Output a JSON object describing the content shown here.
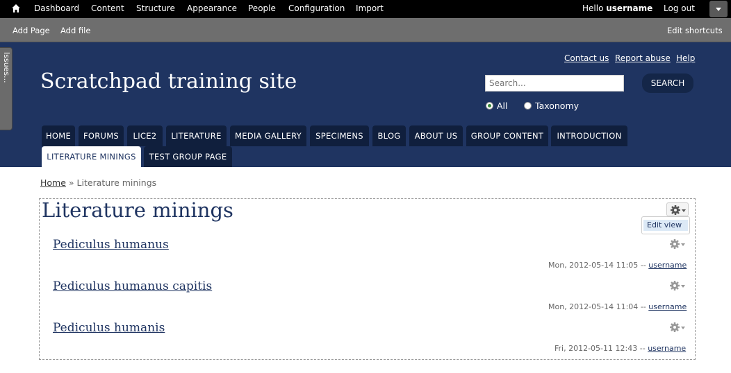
{
  "admin_bar": {
    "menu": [
      "Dashboard",
      "Content",
      "Structure",
      "Appearance",
      "People",
      "Configuration",
      "Import"
    ],
    "hello": "Hello",
    "username": "username",
    "logout": "Log out"
  },
  "shortcuts": {
    "items": [
      "Add Page",
      "Add file"
    ],
    "edit": "Edit shortcuts"
  },
  "issues_tab": "Issues...",
  "header": {
    "links": [
      "Contact us",
      "Report abuse",
      "Help"
    ],
    "site_name": "Scratchpad training site",
    "search_placeholder": "Search...",
    "search_button": "SEARCH",
    "radio_options": [
      {
        "label": "All",
        "checked": true
      },
      {
        "label": "Taxonomy",
        "checked": false
      }
    ]
  },
  "nav": {
    "row1": [
      "HOME",
      "FORUMS",
      "LICE2",
      "LITERATURE",
      "MEDIA GALLERY",
      "SPECIMENS",
      "BLOG",
      "ABOUT US",
      "GROUP CONTENT",
      "INTRODUCTION"
    ],
    "row2": [
      "LITERATURE MININGS",
      "TEST GROUP PAGE"
    ],
    "active": "LITERATURE MININGS"
  },
  "breadcrumb": {
    "home": "Home",
    "separator": "»",
    "current": "Literature minings"
  },
  "view": {
    "title": "Literature minings",
    "edit_view": "Edit view",
    "items": [
      {
        "title": "Pediculus humanus",
        "date": "Mon, 2012-05-14 11:05",
        "sep": "--",
        "user": "username"
      },
      {
        "title": "Pediculus humanus capitis",
        "date": "Mon, 2012-05-14 11:04",
        "sep": "--",
        "user": "username"
      },
      {
        "title": "Pediculus humanis",
        "date": "Fri, 2012-05-11 12:43",
        "sep": "--",
        "user": "username"
      }
    ]
  },
  "colors": {
    "header_bg": "#1f3461",
    "tab_bg": "#101f3d",
    "admin_bg": "#000000",
    "shortcut_bg": "#6e6e6e"
  },
  "icons": [
    "home-icon",
    "gear-icon",
    "chevron-down-icon"
  ]
}
